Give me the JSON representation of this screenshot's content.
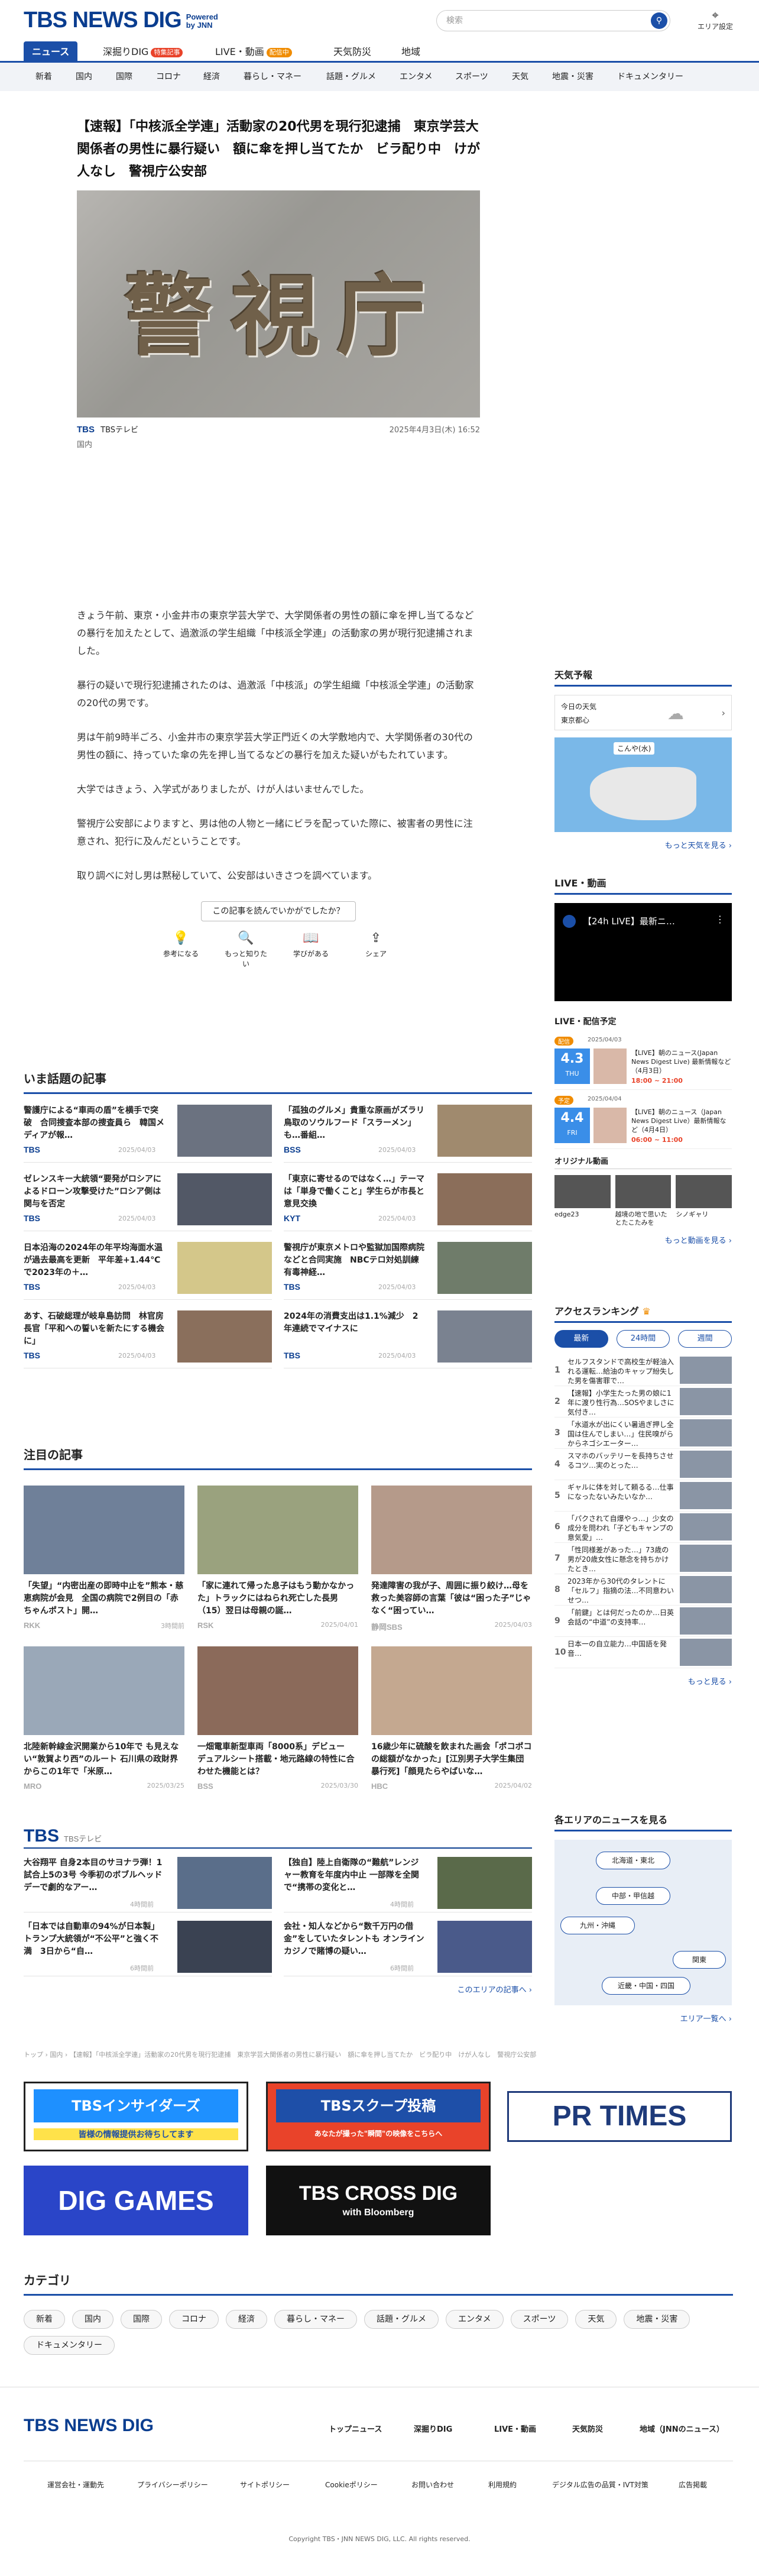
{
  "header": {
    "logo": "TBS NEWS DIG",
    "powered": "Powered by JNN",
    "search_placeholder": "検索",
    "area_label": "エリア設定"
  },
  "main_nav": [
    {
      "label": "ニュース",
      "active": true
    },
    {
      "label": "深掘りDIG",
      "badge": "特集記事"
    },
    {
      "label": "LIVE・動画",
      "badge": "配信中"
    },
    {
      "label": "天気防災"
    },
    {
      "label": "地域"
    }
  ],
  "sub_nav": [
    "新着",
    "国内",
    "国際",
    "コロナ",
    "経済",
    "暮らし・マネー",
    "話題・グルメ",
    "エンタメ",
    "スポーツ",
    "天気",
    "地震・災害",
    "ドキュメンタリー"
  ],
  "article": {
    "title": "【速報】「中核派全学連」活動家の20代男を現行犯逮捕　東京学芸大関係者の男性に暴行疑い　額に傘を押し当てたか　ビラ配り中　けが人なし　警視庁公安部",
    "image_text": "警視庁",
    "source": "TBSテレビ",
    "date": "2025年4月3日(木) 16:52",
    "category": "国内",
    "paragraphs": [
      "きょう午前、東京・小金井市の東京学芸大学で、大学関係者の男性の額に傘を押し当てるなどの暴行を加えたとして、過激派の学生組織「中核派全学連」の活動家の男が現行犯逮捕されました。",
      "暴行の疑いで現行犯逮捕されたのは、過激派「中核派」の学生組織「中核派全学連」の活動家の20代の男です。",
      "男は午前9時半ごろ、小金井市の東京学芸大学正門近くの大学敷地内で、大学関係者の30代の男性の額に、持っていた傘の先を押し当てるなどの暴行を加えた疑いがもたれています。",
      "大学ではきょう、入学式がありましたが、けが人はいませんでした。",
      "警視庁公安部によりますと、男は他の人物と一緒にビラを配っていた際に、被害者の男性に注意され、犯行に及んだということです。",
      "取り調べに対し男は黙秘していて、公安部はいきさつを調べています。"
    ],
    "feedback_question": "この記事を読んでいかがでしたか？",
    "feedback": [
      {
        "icon": "lightbulb-icon",
        "glyph": "💡",
        "label": "参考になる"
      },
      {
        "icon": "search-icon",
        "glyph": "🔍",
        "label": "もっと知りたい"
      },
      {
        "icon": "book-icon",
        "glyph": "📖",
        "label": "学びがある"
      },
      {
        "icon": "share-icon",
        "glyph": "⇪",
        "label": "シェア"
      }
    ]
  },
  "trending": {
    "title": "いま話題の記事",
    "items": [
      {
        "title": "警護庁による“車両の盾”を横手で突破　合同捜査本部の捜査員ら　韓国メディアが報…",
        "pub": "TBS",
        "date": "2025/04/03",
        "color": "#6b7280"
      },
      {
        "title": "「孤独のグルメ」貴重な原画がズラリ　鳥取のソウルフード「スラーメン」も…番組…",
        "pub": "BSS",
        "date": "2025/04/03",
        "color": "#a08a6e"
      },
      {
        "title": "ゼレンスキー大統領“要発がロシアによるドローン攻撃受けた”ロシア側は関与を否定",
        "pub": "TBS",
        "date": "2025/04/03",
        "color": "#525866"
      },
      {
        "title": "「東京に寄せるのではなく…」テーマは「単身で働くこと」学生らが市長と意見交換",
        "pub": "KYT",
        "date": "2025/04/03",
        "color": "#8b6e5a"
      },
      {
        "title": "日本沿海の2024年の年平均海面水温が過去最高を更新　平年差+1.44℃で2023年の＋…",
        "pub": "TBS",
        "date": "2025/04/03",
        "color": "#d4c78a"
      },
      {
        "title": "警視庁が東京メトロや監獄加国際病院などと合同実施　NBCテロ対処訓練　有毒神経…",
        "pub": "TBS",
        "date": "2025/04/03",
        "color": "#6f7c6a"
      },
      {
        "title": "あす、石破総理が岐阜島訪問　林官房長官「平和への誓いを新たにする機会に」",
        "pub": "TBS",
        "date": "2025/04/03",
        "color": "#8a6f5c"
      },
      {
        "title": "2024年の消費支出は1.1%減少　2年連続でマイナスに",
        "pub": "TBS",
        "date": "2025/04/03",
        "color": "#7a8290"
      }
    ]
  },
  "featured": {
    "title": "注目の記事",
    "items": [
      {
        "title": "「失望」“内密出産の即時中止を”熊本・慈恵病院が会見　全国の病院で2例目の「赤ちゃんポスト」開…",
        "pub": "RKK",
        "date": "3時間前",
        "color": "#6f8099"
      },
      {
        "title": "「家に連れて帰った息子はもう動かなかった」トラックにはねられ死亡した長男（15）翌日は母親の誕…",
        "pub": "RSK",
        "date": "2025/04/01",
        "color": "#9aa27e"
      },
      {
        "title": "発達障害の我が子、周囲に振り絞け…母を救った美容師の言葉「彼は“困った子”じゃなく“困ってい…",
        "pub": "静岡SBS",
        "date": "2025/04/03",
        "color": "#b59a8a"
      },
      {
        "title": "北陸新幹線金沢開業から10年で も見えない“敦賀より西”のルート 石川県の政財界からこの1年で「米原…",
        "pub": "MRO",
        "date": "2025/03/25",
        "color": "#9aa8b8"
      },
      {
        "title": "一畑電車新型車両「8000系」デビュー　デュアルシート搭載・地元路線の特性に合わせた機能とは？",
        "pub": "BSS",
        "date": "2025/03/30",
        "color": "#8b6a5a"
      },
      {
        "title": "16歳少年に硫酸を飲まれた画会「ポコポコの総額がなかった」[江別男子大学生集団暴行死]「顔見たらやばいな…",
        "pub": "HBC",
        "date": "2025/04/02",
        "color": "#c4a890"
      }
    ]
  },
  "tbs_section": {
    "title": "TBS",
    "subtitle": "TBSテレビ",
    "items": [
      {
        "title": "大谷翔平 自身2本目のサヨナラ弾！1試合上5の3号 今季初のボブルヘッドデーで劇的なアー…",
        "date": "4時間前",
        "color": "#5a6e8a"
      },
      {
        "title": "【独自】陸上自衛隊の“難航”レンジャー教育を年度内中止 一部隊を全関で“携帯の変化と…",
        "date": "4時間前",
        "color": "#5a6a4a"
      },
      {
        "title": "「日本では自動車の94%が日本製」トランプ大統領が“不公平”と強く不満　3日から“自…",
        "date": "6時間前",
        "color": "#3a4252"
      },
      {
        "title": "会社・知人などから“数千万円の借金”をしていたタレントも オンラインカジノで賭博の疑い…",
        "date": "6時間前",
        "color": "#4a5a8a"
      }
    ],
    "more": "このエリアの記事へ ›"
  },
  "breadcrumb": [
    "トップ",
    "国内",
    "【速報】「中核派全学連」活動家の20代男を現行犯逮捕　東京学芸大関係者の男性に暴行疑い　額に傘を押し当てたか　ビラ配り中　けが人なし　警視庁公安部"
  ],
  "banners": [
    {
      "label": "TBSインサイダーズ",
      "sub": "皆様の情報提供お待ちしてます",
      "bg": "#1e90ff"
    },
    {
      "label": "TBSスクープ投稿",
      "sub": "あなたが撮った\"瞬間\"の映像をこちらへ",
      "bg": "#e9432a"
    },
    {
      "label": "PR TIMES",
      "sub": "",
      "bg": "#ffffff"
    },
    {
      "label": "DIG GAMES",
      "sub": "",
      "bg": "#2a45c8"
    },
    {
      "label": "TBS CROSS DIG",
      "sub": "with Bloomberg",
      "bg": "#111111"
    }
  ],
  "categories": {
    "title": "カテゴリ",
    "items": [
      "新着",
      "国内",
      "国際",
      "コロナ",
      "経済",
      "暮らし・マネー",
      "話題・グルメ",
      "エンタメ",
      "スポーツ",
      "天気",
      "地震・災害",
      "ドキュメンタリー"
    ]
  },
  "sidebar": {
    "weather": {
      "title": "天気予報",
      "today": "今日の天気",
      "region": "東京都心",
      "more": "もっと天気を見る ›",
      "map_label": "こんや(水)"
    },
    "live": {
      "title": "LIVE・動画",
      "video_title": "【24h LIVE】最新ニ…",
      "schedule_title": "LIVE・配信予定",
      "schedule": [
        {
          "badge": "配信",
          "date": "2025/04/03",
          "day": "4.3",
          "weekday": "THU",
          "title": "【LIVE】朝のニュース(Japan News Digest Live) 最新情報など（4月3日）",
          "time": "18:00 ~ 21:00"
        },
        {
          "badge": "予定",
          "date": "2025/04/04",
          "day": "4.4",
          "weekday": "FRI",
          "title": "【LIVE】朝のニュース（Japan News Digest Live）最新情報など（4月4日）",
          "time": "06:00 ~ 11:00"
        }
      ],
      "original_title": "オリジナル動画",
      "originals": [
        "edge23",
        "越境の地で思いたとたこたみを",
        "シノギャリ"
      ],
      "more": "もっと動画を見る ›"
    },
    "ranking": {
      "title": "アクセスランキング",
      "tabs": [
        {
          "label": "最新",
          "active": true
        },
        {
          "label": "24時間"
        },
        {
          "label": "週間"
        }
      ],
      "items": [
        "セルフスタンドで高校生が軽油入れる運転…給油のキャップ紛失した男を傷害罪で…",
        "【速報】小学生たった男の娘に1年に渡り性行為…SOSやましさに気付き…",
        "「水道水が出にくい暑過ぎ押し全国は住んでしまい…」住民嗅がらからネゴシエーター…",
        "スマホのバッテリーを長持ちさせるコツ…実のとった…",
        "ギャルに体を対して頼るる…仕事になったないみたいなか…",
        "「パクされて自爆やっ…」少女の成分を問われ「子どもキャンプの意気愛」…",
        "「性同様差があった…」73歳の男が20歳女性に懸念を持ちかけたとき…",
        "2023年から30代のタレントに「セルフ」指摘の法…不同意わいせつ…",
        "「前鍵」とは何だったのか…日英会話の“中道”の支持率…",
        "日本一の自立能力…中国語を発音…"
      ],
      "more": "もっと見る ›"
    },
    "areas": {
      "title": "各エリアのニュースを見る",
      "buttons": [
        "北海道・東北",
        "中部・甲信越",
        "九州・沖縄",
        "関東",
        "近畿・中国・四国"
      ],
      "more": "エリア一覧へ ›"
    }
  },
  "footer": {
    "logo": "TBS NEWS DIG",
    "nav": [
      "トップニュース",
      "深掘りDIG",
      "LIVE・動画",
      "天気防災",
      "地域（JNNのニュース）"
    ],
    "links": [
      "運営会社・運動先",
      "プライバシーポリシー",
      "サイトポリシー",
      "Cookieポリシー",
      "お問い合わせ",
      "利用規約",
      "デジタル広告の品質・IVT対策",
      "広告掲載"
    ],
    "copyright": "Copyright TBS・JNN NEWS DIG, LLC. All rights reserved."
  }
}
